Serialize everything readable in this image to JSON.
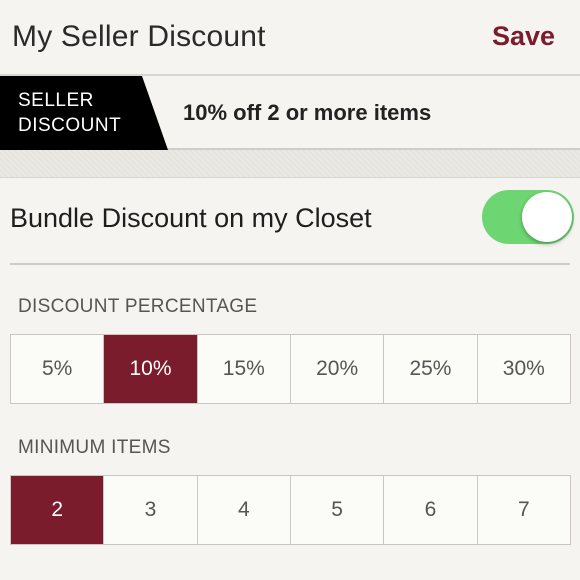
{
  "header": {
    "title": "My Seller Discount",
    "save_label": "Save"
  },
  "banner": {
    "tag": "SELLER DISCOUNT",
    "text": "10% off 2 or more items"
  },
  "bundle": {
    "label": "Bundle Discount on my Closet",
    "enabled": true
  },
  "discount_percentage": {
    "label": "DISCOUNT PERCENTAGE",
    "options": [
      "5%",
      "10%",
      "15%",
      "20%",
      "25%",
      "30%"
    ],
    "selected": "10%"
  },
  "minimum_items": {
    "label": "MINIMUM ITEMS",
    "options": [
      "2",
      "3",
      "4",
      "5",
      "6",
      "7"
    ],
    "selected": "2"
  },
  "colors": {
    "accent": "#7a1c2b",
    "toggle_on": "#6dd672"
  }
}
